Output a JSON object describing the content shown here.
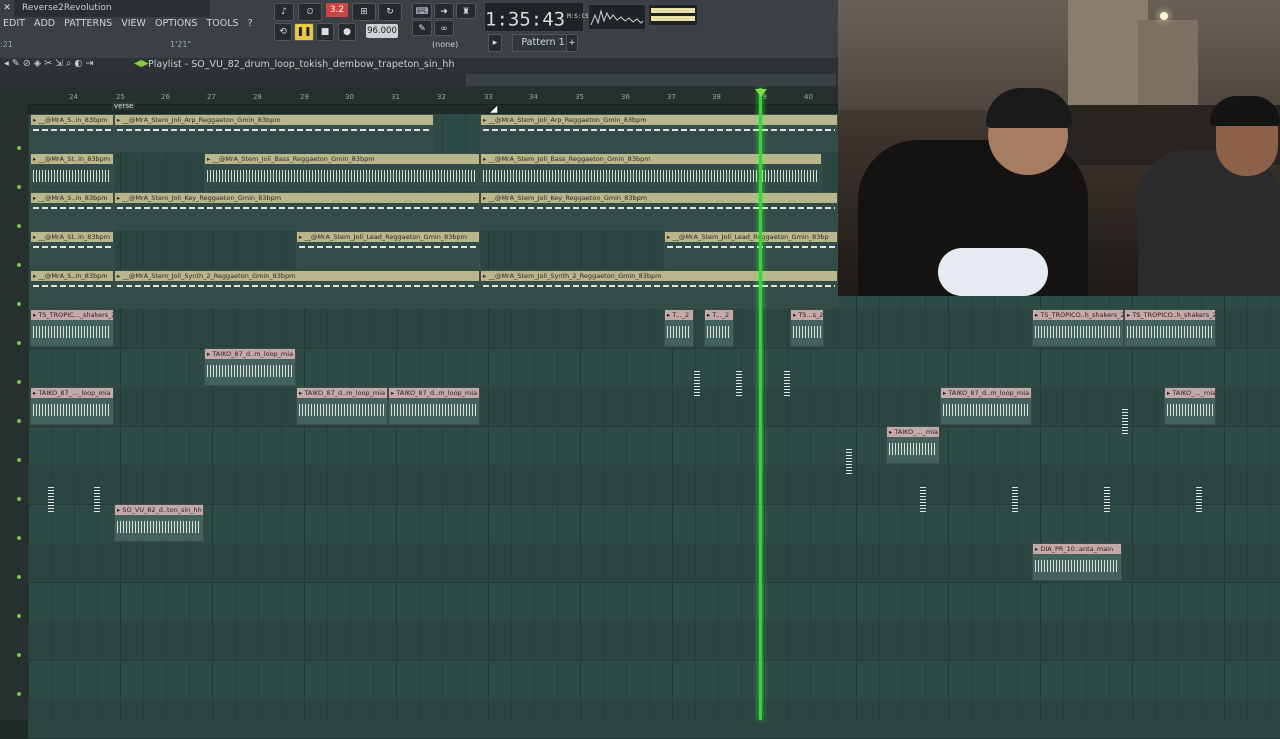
{
  "window": {
    "title": "Reverse2Revolution"
  },
  "menu": [
    "EDIT",
    "ADD",
    "PATTERNS",
    "VIEW",
    "OPTIONS",
    "TOOLS",
    "?"
  ],
  "status": {
    "left": ":21",
    "right": "1'21\""
  },
  "transport": {
    "pitch": "3.2",
    "tempo": "96.000",
    "time": "1:35:43",
    "time_unit": "M:S:CS",
    "none_label": "(none)",
    "pattern": "Pattern 1"
  },
  "playlist": {
    "title": "Playlist - SO_VU_82_drum_loop_tokish_dembow_trapeton_sin_hh",
    "marker": "verse"
  },
  "ruler": [
    "24",
    "25",
    "26",
    "27",
    "28",
    "29",
    "30",
    "31",
    "32",
    "33",
    "34",
    "35",
    "36",
    "37",
    "38",
    "39",
    "40"
  ],
  "clips": [
    {
      "label": "__@MrA_S..in_83bpm"
    },
    {
      "label": "__@MrA_Stem_Joli_Arp_Reggaeton_Gmin_83bpm"
    },
    {
      "label": "__@MrA_Stem_Joli_Arp_Reggaeton_Gmin_83bpm"
    },
    {
      "label": "__@MrA_St..in_83bpm"
    },
    {
      "label": "__@MrA_Stem_Joli_Bass_Reggaeton_Gmin_83bpm"
    },
    {
      "label": "__@MrA_Stem_Joli_Bass_Reggaeton_Gmin_83bpm"
    },
    {
      "label": "__@MrA_S..in_83bpm"
    },
    {
      "label": "__@MrA_Stem_Joli_Key_Reggaeton_Gmin_83bpm"
    },
    {
      "label": "__@MrA_Stem_Joli_Key_Reggaeton_Gmin_83bpm"
    },
    {
      "label": "__@MrA_St..in_83bpm"
    },
    {
      "label": "__@MrA_Stem_Joli_Lead_Reggaeton_Gmin_83bpm"
    },
    {
      "label": "__@MrA_Stem_Joli_Lead_Reggaeton_Gmin_83bp"
    },
    {
      "label": "__@MrA_S..in_83bpm"
    },
    {
      "label": "__@MrA_Stem_Joli_Synth_2_Reggaeton_Gmin_83bpm"
    },
    {
      "label": "__@MrA_Stem_Joli_Synth_2_Reggaeton_Gmin_83bpm"
    },
    {
      "label": "TS_TROPIC..._shakers_2"
    },
    {
      "label": "T..._2"
    },
    {
      "label": "T..._2"
    },
    {
      "label": "TS...s_2"
    },
    {
      "label": "TS_TROPICO..h_shakers_2"
    },
    {
      "label": "TS_TROPICO..h_shakers_2"
    },
    {
      "label": "TAIKO_87_d..m_loop_mia"
    },
    {
      "label": "TAIKO_87_..._loop_mia"
    },
    {
      "label": "TAIKO_87_d..m_loop_mia"
    },
    {
      "label": "TAIKO_87_d..m_loop_mia"
    },
    {
      "label": "TAIKO_87_d..m_loop_mia"
    },
    {
      "label": "TAIKO_..._mia"
    },
    {
      "label": "TAIKO_..._mia"
    },
    {
      "label": "SO_VU_82_d..ton_sin_hh"
    },
    {
      "label": "DIA_PR_10..anta_main"
    }
  ],
  "colors": {
    "grid": "#2e4a45",
    "playhead": "#39d23a",
    "clip_melody": "#c9c49d",
    "clip_drum": "#c3a9a9"
  }
}
